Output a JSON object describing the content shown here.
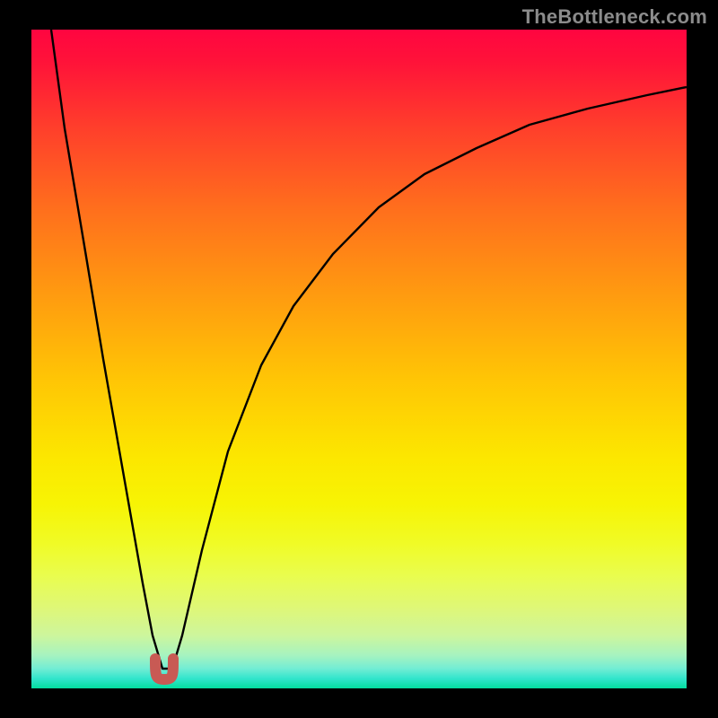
{
  "watermark": "TheBottleneck.com",
  "chart_data": {
    "type": "line",
    "title": "",
    "xlabel": "",
    "ylabel": "",
    "xlim": [
      0,
      100
    ],
    "ylim": [
      0,
      100
    ],
    "grid": false,
    "legend": false,
    "series": [
      {
        "name": "bottleneck-curve",
        "x": [
          3,
          5,
          8,
          11,
          14,
          17,
          18.5,
          20,
          21.5,
          23,
          26,
          30,
          35,
          40,
          46,
          53,
          60,
          68,
          76,
          85,
          94,
          100
        ],
        "y": [
          100,
          85,
          68,
          50,
          33,
          16,
          8,
          3,
          3,
          8,
          21,
          36,
          49,
          58,
          66,
          73,
          78,
          82,
          85.5,
          88,
          90,
          91.3
        ]
      }
    ],
    "markers": [
      {
        "name": "valley-marker",
        "x": 20.3,
        "y": 2.5,
        "color": "#c85a54",
        "shape": "u"
      }
    ],
    "background": {
      "type": "vertical-gradient",
      "stops": [
        {
          "pos": 0.0,
          "color": "#ff0540"
        },
        {
          "pos": 0.5,
          "color": "#ffc505"
        },
        {
          "pos": 0.8,
          "color": "#f0fb26"
        },
        {
          "pos": 1.0,
          "color": "#03dd9f"
        }
      ]
    }
  }
}
